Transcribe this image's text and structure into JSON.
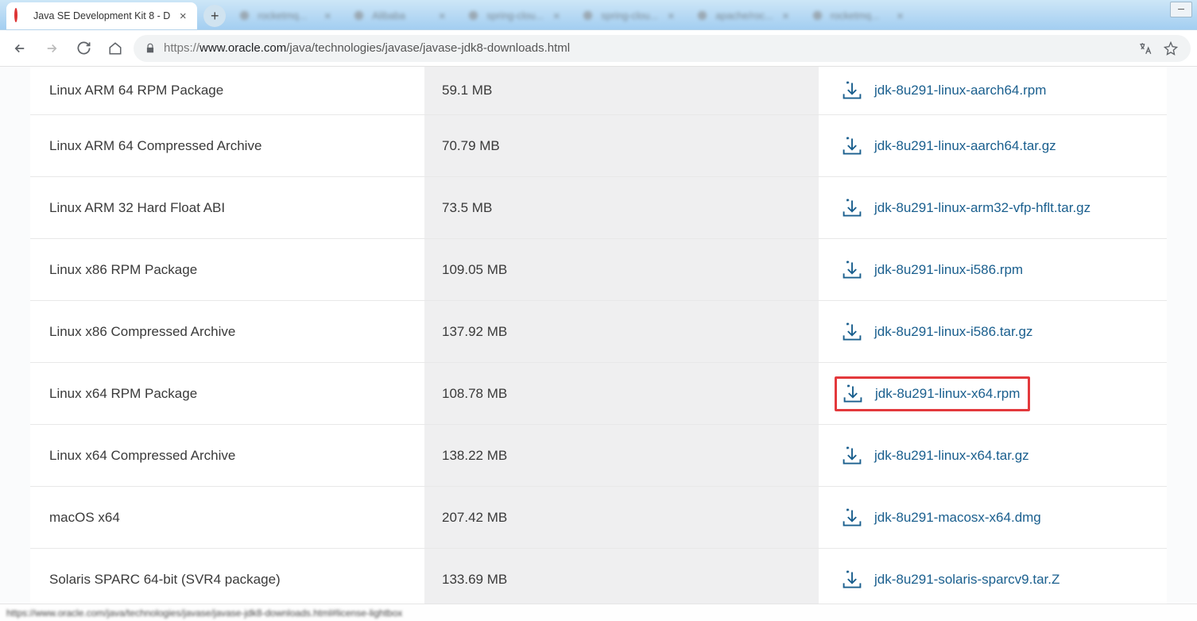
{
  "browser": {
    "active_tab_title": "Java SE Development Kit 8 - D",
    "inactive_tabs": [
      {
        "title": "rocketmq..."
      },
      {
        "title": "Alibaba"
      },
      {
        "title": "spring-clou..."
      },
      {
        "title": "spring-clou..."
      },
      {
        "title": "apache/roc..."
      },
      {
        "title": "rocketmq..."
      }
    ],
    "url": {
      "scheme": "https://",
      "host": "www.oracle.com",
      "path": "/java/technologies/javase/javase-jdk8-downloads.html"
    },
    "status_text": "https://www.oracle.com/java/technologies/javase/javase-jdk8-downloads.html#license-lightbox"
  },
  "link_color": "#1a5f8e",
  "highlight_color": "#e3393c",
  "downloads": [
    {
      "product": "Linux ARM 64 RPM Package",
      "size": "59.1 MB",
      "file": "jdk-8u291-linux-aarch64.rpm",
      "highlighted": false
    },
    {
      "product": "Linux ARM 64 Compressed Archive",
      "size": "70.79 MB",
      "file": "jdk-8u291-linux-aarch64.tar.gz",
      "highlighted": false
    },
    {
      "product": "Linux ARM 32 Hard Float ABI",
      "size": "73.5 MB",
      "file": "jdk-8u291-linux-arm32-vfp-hflt.tar.gz",
      "highlighted": false
    },
    {
      "product": "Linux x86 RPM Package",
      "size": "109.05 MB",
      "file": "jdk-8u291-linux-i586.rpm",
      "highlighted": false
    },
    {
      "product": "Linux x86 Compressed Archive",
      "size": "137.92 MB",
      "file": "jdk-8u291-linux-i586.tar.gz",
      "highlighted": false
    },
    {
      "product": "Linux x64 RPM Package",
      "size": "108.78 MB",
      "file": "jdk-8u291-linux-x64.rpm",
      "highlighted": true
    },
    {
      "product": "Linux x64 Compressed Archive",
      "size": "138.22 MB",
      "file": "jdk-8u291-linux-x64.tar.gz",
      "highlighted": false
    },
    {
      "product": "macOS x64",
      "size": "207.42 MB",
      "file": "jdk-8u291-macosx-x64.dmg",
      "highlighted": false
    },
    {
      "product": "Solaris SPARC 64-bit (SVR4 package)",
      "size": "133.69 MB",
      "file": "jdk-8u291-solaris-sparcv9.tar.Z",
      "highlighted": false
    }
  ]
}
